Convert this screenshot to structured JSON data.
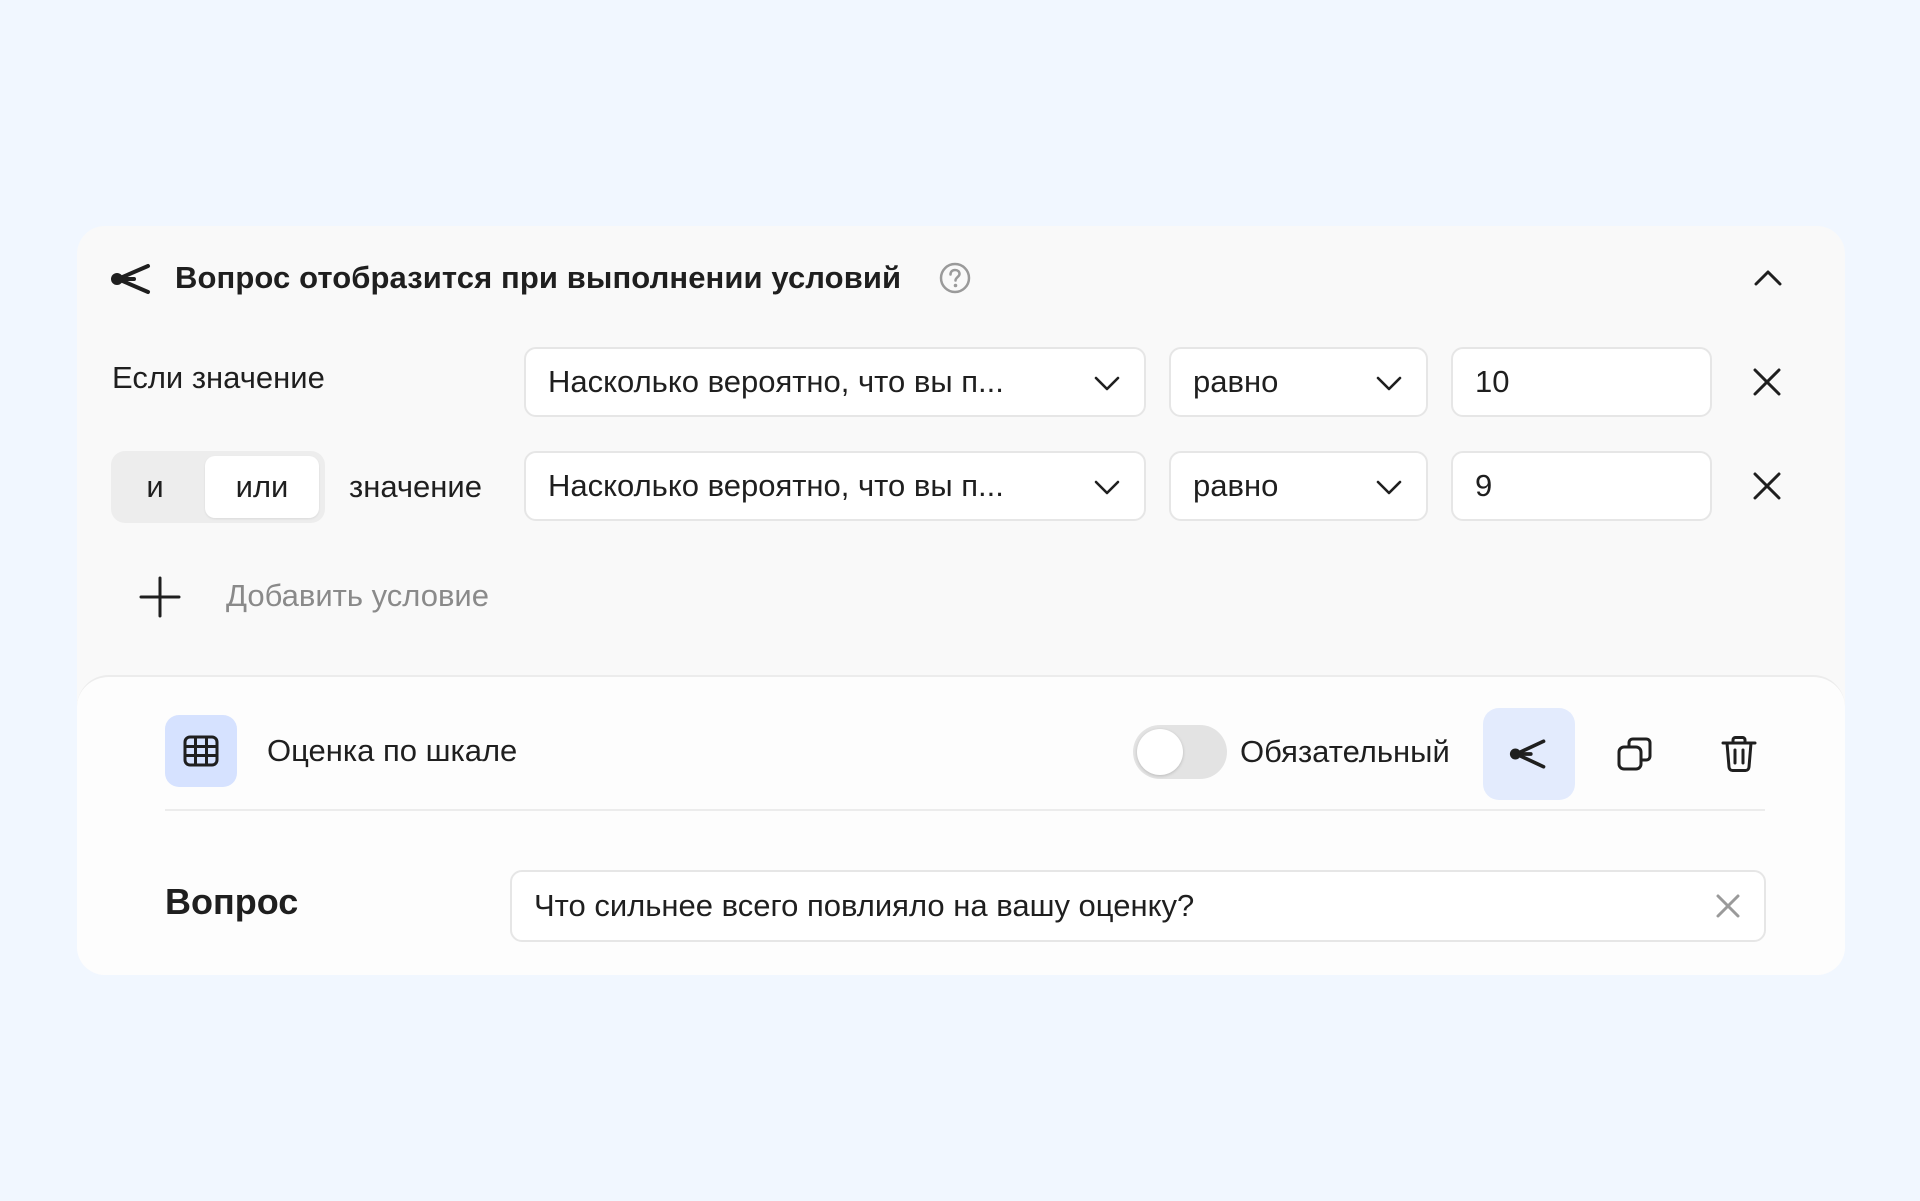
{
  "header": {
    "title": "Вопрос отобразится при выполнении условий",
    "icons": {
      "branch": "branch-icon",
      "help": "help-circle-icon",
      "collapse": "chevron-up-icon"
    }
  },
  "conditions": {
    "first_label": "Если значение",
    "rows": [
      {
        "question": "Насколько вероятно, что вы п...",
        "operator": "равно",
        "value": "10"
      },
      {
        "question": "Насколько вероятно, что вы п...",
        "operator": "равно",
        "value": "9"
      }
    ],
    "logic": {
      "and_label": "и",
      "or_label": "или",
      "selected": "или"
    },
    "second_label": "значение",
    "add_label": "Добавить условие"
  },
  "question_block": {
    "type_label": "Оценка по шкале",
    "required_label": "Обязательный",
    "required_on": false,
    "question_label": "Вопрос",
    "question_value": "Что сильнее всего повлияло на вашу оценку?",
    "icons": {
      "type": "grid-icon",
      "branch": "branch-icon",
      "copy": "copy-icon",
      "delete": "trash-icon"
    }
  },
  "colors": {
    "background": "#f1f7ff",
    "card": "#f9f9f9",
    "accent_soft": "#d6e2ff",
    "active_button": "#e3ebfd"
  }
}
